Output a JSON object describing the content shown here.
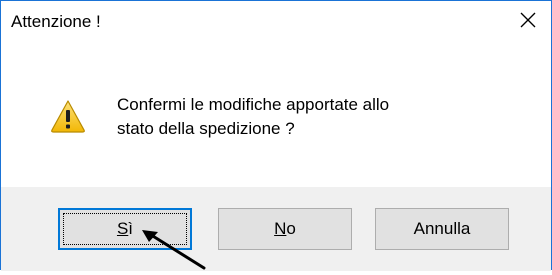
{
  "dialog": {
    "title": "Attenzione !",
    "message_lines": [
      "Confermi le modifiche apportate allo",
      "stato della spedizione ?"
    ]
  },
  "buttons": {
    "yes_label": "Sì",
    "no_label": "No",
    "cancel_label": "Annulla"
  },
  "icons": {
    "warning": "warning-triangle-icon",
    "close": "close-icon",
    "cursor": "mouse-arrow-cursor"
  },
  "colors": {
    "window_border": "#1a73d6",
    "footer_background": "#f0f0f0",
    "button_face": "#e1e1e1",
    "default_button_border": "#0078d7",
    "warning_yellow": "#f6c528"
  }
}
